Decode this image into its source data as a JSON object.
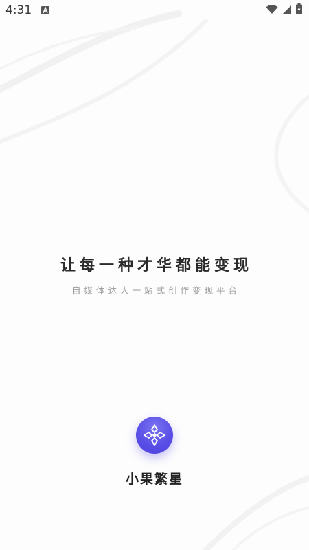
{
  "status_bar": {
    "time": "4:31",
    "notification_icon": "a-icon",
    "wifi_icon": "wifi-icon",
    "signal_icon": "signal-icon",
    "battery_icon": "battery-charging-icon"
  },
  "slogan": {
    "title": "让每一种才华都能变现",
    "subtitle": "自媒体达人一站式创作变现平台"
  },
  "app": {
    "name": "小果繁星",
    "logo_icon": "diamond-star-logo-icon",
    "accent_color": "#5a4fe6"
  }
}
